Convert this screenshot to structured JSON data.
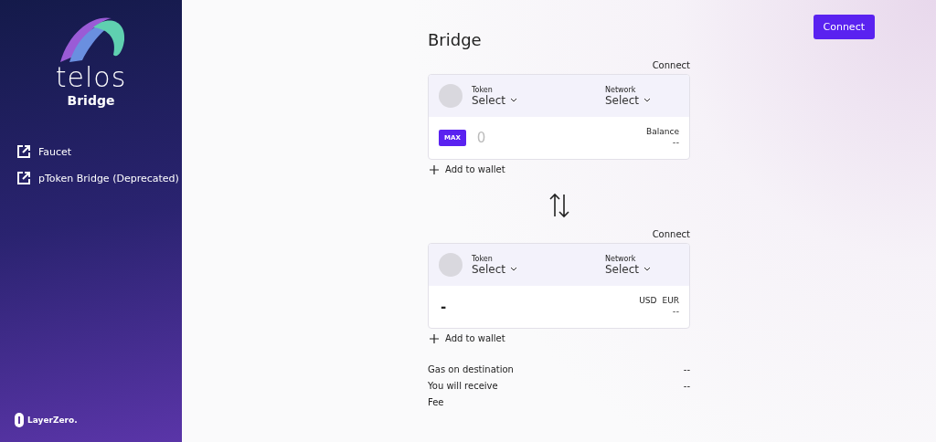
{
  "sidebar": {
    "logo_word": "telos",
    "logo_sub": "Bridge",
    "links": [
      {
        "label": "Faucet"
      },
      {
        "label": "pToken Bridge (Deprecated)"
      }
    ],
    "footer": "LayerZero."
  },
  "header": {
    "button": "Connect"
  },
  "title": "Bridge",
  "panels": [
    {
      "connect": "Connect",
      "token_label": "Token",
      "token_value": "Select",
      "network_label": "Network",
      "network_value": "Select",
      "kind": "source",
      "max": "MAX",
      "amount": "0",
      "right_label": "Balance",
      "right_value": "--",
      "add": "Add to wallet"
    },
    {
      "connect": "Connect",
      "token_label": "Token",
      "token_value": "Select",
      "network_label": "Network",
      "network_value": "Select",
      "kind": "target",
      "amount": "-",
      "currencies": [
        "USD",
        "EUR"
      ],
      "right_value": "--",
      "add": "Add to wallet"
    }
  ],
  "summary": [
    {
      "label": "Gas on destination",
      "value": "--"
    },
    {
      "label": "You will receive",
      "value": "--"
    },
    {
      "label": "Fee"
    }
  ]
}
